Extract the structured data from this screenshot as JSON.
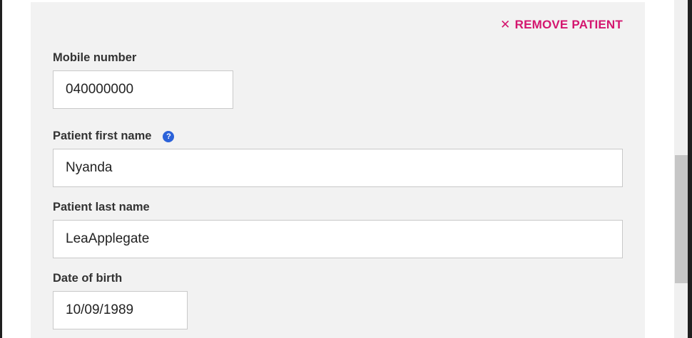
{
  "remove_patient": {
    "icon": "close-icon",
    "label": "REMOVE PATIENT"
  },
  "fields": {
    "mobile": {
      "label": "Mobile number",
      "value": "040000000"
    },
    "first_name": {
      "label": "Patient first name",
      "value": "Nyanda",
      "help_icon": "help-icon"
    },
    "last_name": {
      "label": "Patient last name",
      "value": "LeaApplegate"
    },
    "dob": {
      "label": "Date of birth",
      "value": "10/09/1989"
    }
  },
  "colors": {
    "accent": "#d4166f",
    "help": "#2b62d9",
    "panel": "#f2f2f2"
  }
}
